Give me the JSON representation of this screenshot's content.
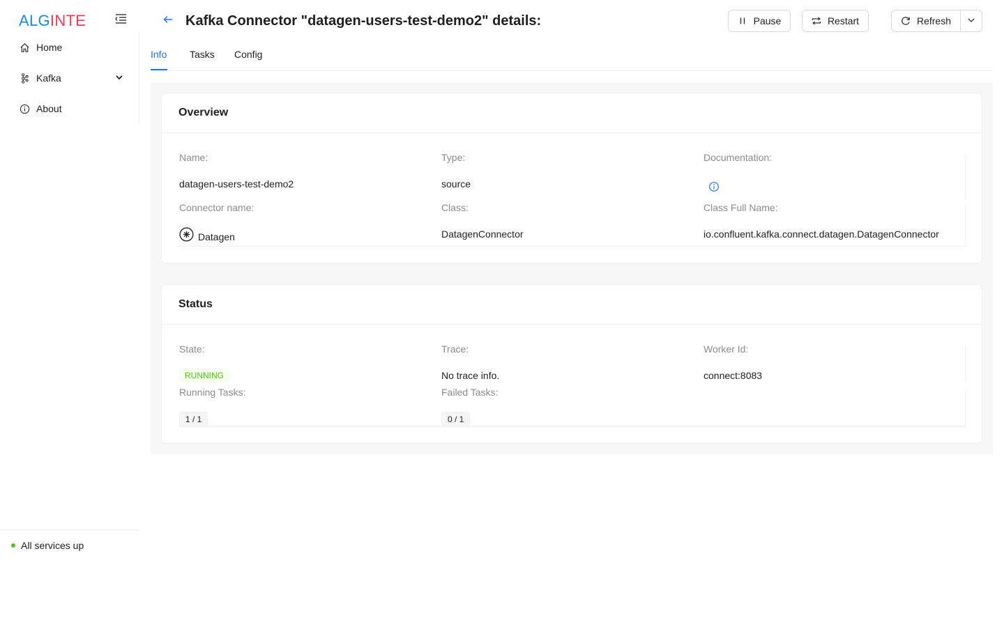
{
  "app": {
    "logo_part1": "ALG",
    "logo_part2": "INTE",
    "logo_color_1": "#1e88e5",
    "logo_color_2": "#f23b52"
  },
  "sidebar": {
    "items": [
      {
        "label": "Home",
        "icon": "home-icon"
      },
      {
        "label": "Kafka",
        "icon": "kafka-icon"
      },
      {
        "label": "About",
        "icon": "info-icon"
      }
    ],
    "footer_status": "All services up",
    "status_color": "#52c41a"
  },
  "header": {
    "title": "Kafka Connector \"datagen-users-test-demo2\" details:",
    "pause_label": "Pause",
    "restart_label": "Restart",
    "refresh_label": "Refresh"
  },
  "tabs": [
    {
      "label": "Info",
      "active": true
    },
    {
      "label": "Tasks",
      "active": false
    },
    {
      "label": "Config",
      "active": false
    }
  ],
  "overview": {
    "title": "Overview",
    "name_label": "Name",
    "name_value": "datagen-users-test-demo2",
    "type_label": "Type",
    "type_value": "source",
    "doc_label": "Documentation",
    "connector_name_label": "Connector name",
    "connector_name_value": "Datagen",
    "class_label": "Class",
    "class_value": "DatagenConnector",
    "class_full_label": "Class Full Name",
    "class_full_value": "io.confluent.kafka.connect.datagen.DatagenConnector"
  },
  "status": {
    "title": "Status",
    "state_label": "State",
    "state_value": "RUNNING",
    "trace_label": "Trace",
    "trace_value": "No trace info.",
    "worker_label": "Worker Id",
    "worker_value": "connect:8083",
    "running_label": "Running Tasks",
    "running_value": "1 / 1",
    "failed_label": "Failed Tasks",
    "failed_value": "0 / 1"
  },
  "colors": {
    "accent": "#1677ff",
    "running": "#52c41a"
  }
}
